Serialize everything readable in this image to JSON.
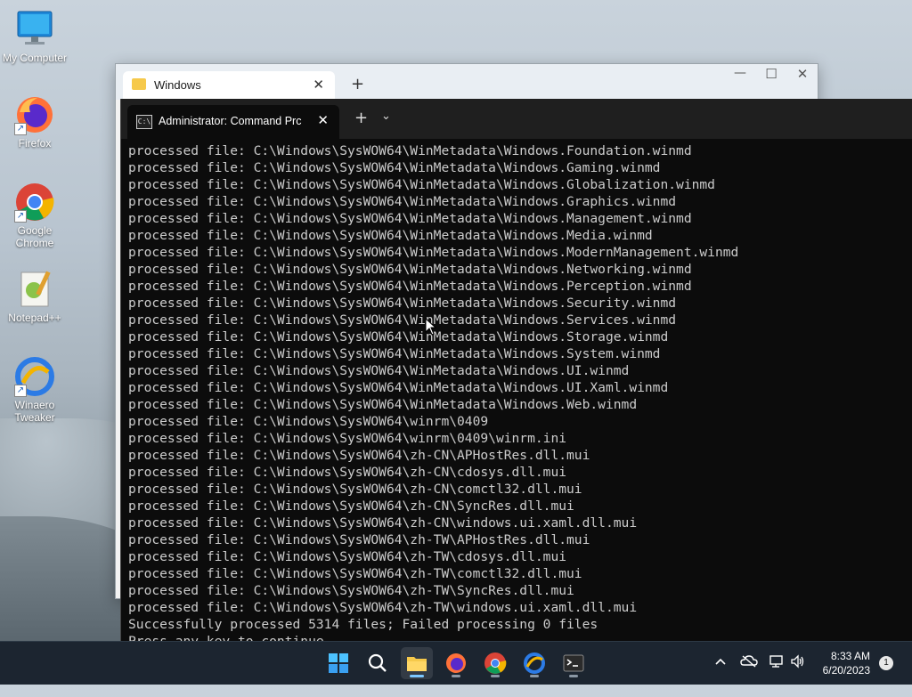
{
  "desktop": {
    "icons": [
      {
        "label": "My Computer",
        "icon": "computer-icon"
      },
      {
        "label": "Firefox",
        "icon": "firefox-icon"
      },
      {
        "label": "Google Chrome",
        "icon": "chrome-icon"
      },
      {
        "label": "Notepad++",
        "icon": "notepadpp-icon"
      },
      {
        "label": "Winaero Tweaker",
        "icon": "winaero-icon"
      }
    ]
  },
  "explorer": {
    "tab_title": "Windows",
    "new_tab": "+",
    "close_tab": "✕"
  },
  "terminal": {
    "tab_title": "Administrator:  Command Prc",
    "lines": [
      "processed file: C:\\Windows\\SysWOW64\\WinMetadata\\Windows.Foundation.winmd",
      "processed file: C:\\Windows\\SysWOW64\\WinMetadata\\Windows.Gaming.winmd",
      "processed file: C:\\Windows\\SysWOW64\\WinMetadata\\Windows.Globalization.winmd",
      "processed file: C:\\Windows\\SysWOW64\\WinMetadata\\Windows.Graphics.winmd",
      "processed file: C:\\Windows\\SysWOW64\\WinMetadata\\Windows.Management.winmd",
      "processed file: C:\\Windows\\SysWOW64\\WinMetadata\\Windows.Media.winmd",
      "processed file: C:\\Windows\\SysWOW64\\WinMetadata\\Windows.ModernManagement.winmd",
      "processed file: C:\\Windows\\SysWOW64\\WinMetadata\\Windows.Networking.winmd",
      "processed file: C:\\Windows\\SysWOW64\\WinMetadata\\Windows.Perception.winmd",
      "processed file: C:\\Windows\\SysWOW64\\WinMetadata\\Windows.Security.winmd",
      "processed file: C:\\Windows\\SysWOW64\\WinMetadata\\Windows.Services.winmd",
      "processed file: C:\\Windows\\SysWOW64\\WinMetadata\\Windows.Storage.winmd",
      "processed file: C:\\Windows\\SysWOW64\\WinMetadata\\Windows.System.winmd",
      "processed file: C:\\Windows\\SysWOW64\\WinMetadata\\Windows.UI.winmd",
      "processed file: C:\\Windows\\SysWOW64\\WinMetadata\\Windows.UI.Xaml.winmd",
      "processed file: C:\\Windows\\SysWOW64\\WinMetadata\\Windows.Web.winmd",
      "processed file: C:\\Windows\\SysWOW64\\winrm\\0409",
      "processed file: C:\\Windows\\SysWOW64\\winrm\\0409\\winrm.ini",
      "processed file: C:\\Windows\\SysWOW64\\zh-CN\\APHostRes.dll.mui",
      "processed file: C:\\Windows\\SysWOW64\\zh-CN\\cdosys.dll.mui",
      "processed file: C:\\Windows\\SysWOW64\\zh-CN\\comctl32.dll.mui",
      "processed file: C:\\Windows\\SysWOW64\\zh-CN\\SyncRes.dll.mui",
      "processed file: C:\\Windows\\SysWOW64\\zh-CN\\windows.ui.xaml.dll.mui",
      "processed file: C:\\Windows\\SysWOW64\\zh-TW\\APHostRes.dll.mui",
      "processed file: C:\\Windows\\SysWOW64\\zh-TW\\cdosys.dll.mui",
      "processed file: C:\\Windows\\SysWOW64\\zh-TW\\comctl32.dll.mui",
      "processed file: C:\\Windows\\SysWOW64\\zh-TW\\SyncRes.dll.mui",
      "processed file: C:\\Windows\\SysWOW64\\zh-TW\\windows.ui.xaml.dll.mui",
      "Successfully processed 5314 files; Failed processing 0 files",
      "Press any key to continue . . ."
    ]
  },
  "taskbar": {
    "apps": [
      {
        "name": "start",
        "icon": "windows-start-icon"
      },
      {
        "name": "search",
        "icon": "search-icon"
      },
      {
        "name": "file-explorer",
        "icon": "folder-icon"
      },
      {
        "name": "firefox",
        "icon": "firefox-icon"
      },
      {
        "name": "chrome",
        "icon": "chrome-icon"
      },
      {
        "name": "winaero",
        "icon": "winaero-icon"
      },
      {
        "name": "terminal",
        "icon": "terminal-icon"
      }
    ],
    "time": "8:33 AM",
    "date": "6/20/2023",
    "notification_count": "1"
  },
  "colors": {
    "terminal_bg": "#0c0c0c",
    "terminal_text": "#cccccc",
    "taskbar_bg": "#1c2530",
    "accent": "#0078d4"
  }
}
